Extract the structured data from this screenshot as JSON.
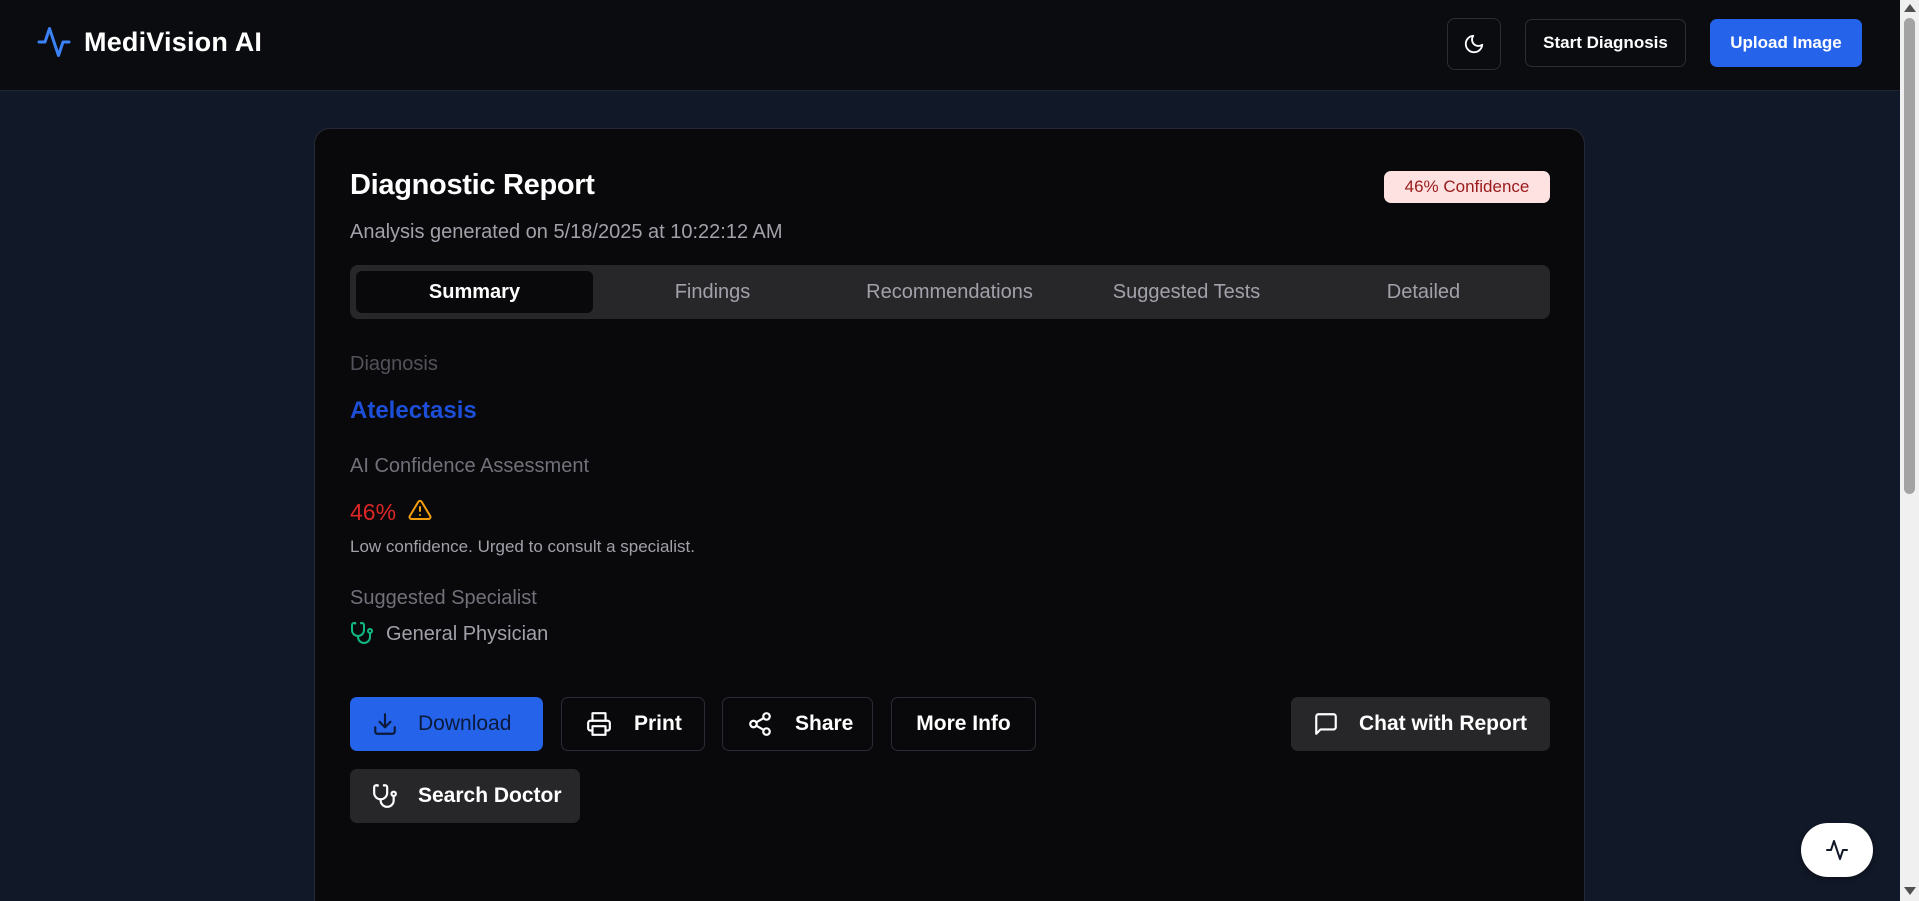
{
  "app": {
    "name": "MediVision AI"
  },
  "header": {
    "theme_toggle_icon": "moon-icon",
    "start_label": "Start Diagnosis",
    "upload_label": "Upload Image"
  },
  "report": {
    "title": "Diagnostic Report",
    "subtitle": "Analysis generated on 5/18/2025 at 10:22:12 AM",
    "confidence_badge": "46% Confidence",
    "tabs": [
      {
        "label": "Summary",
        "active": true
      },
      {
        "label": "Findings",
        "active": false
      },
      {
        "label": "Recommendations",
        "active": false
      },
      {
        "label": "Suggested Tests",
        "active": false
      },
      {
        "label": "Detailed",
        "active": false
      }
    ],
    "diagnosis_label": "Diagnosis",
    "diagnosis_value": "Atelectasis",
    "confidence_label": "AI Confidence Assessment",
    "confidence_value": "46%",
    "confidence_note": "Low confidence. Urged to consult a specialist.",
    "specialist_label": "Suggested Specialist",
    "specialist_value": "General Physician"
  },
  "actions": {
    "download": "Download",
    "print": "Print",
    "share": "Share",
    "more_info": "More Info",
    "chat": "Chat with Report",
    "search_doctor": "Search Doctor"
  },
  "colors": {
    "accent": "#2563eb",
    "danger": "#dc2626",
    "warning": "#f59e0b",
    "success": "#10b981",
    "background": "#111827",
    "card": "#09090b"
  }
}
